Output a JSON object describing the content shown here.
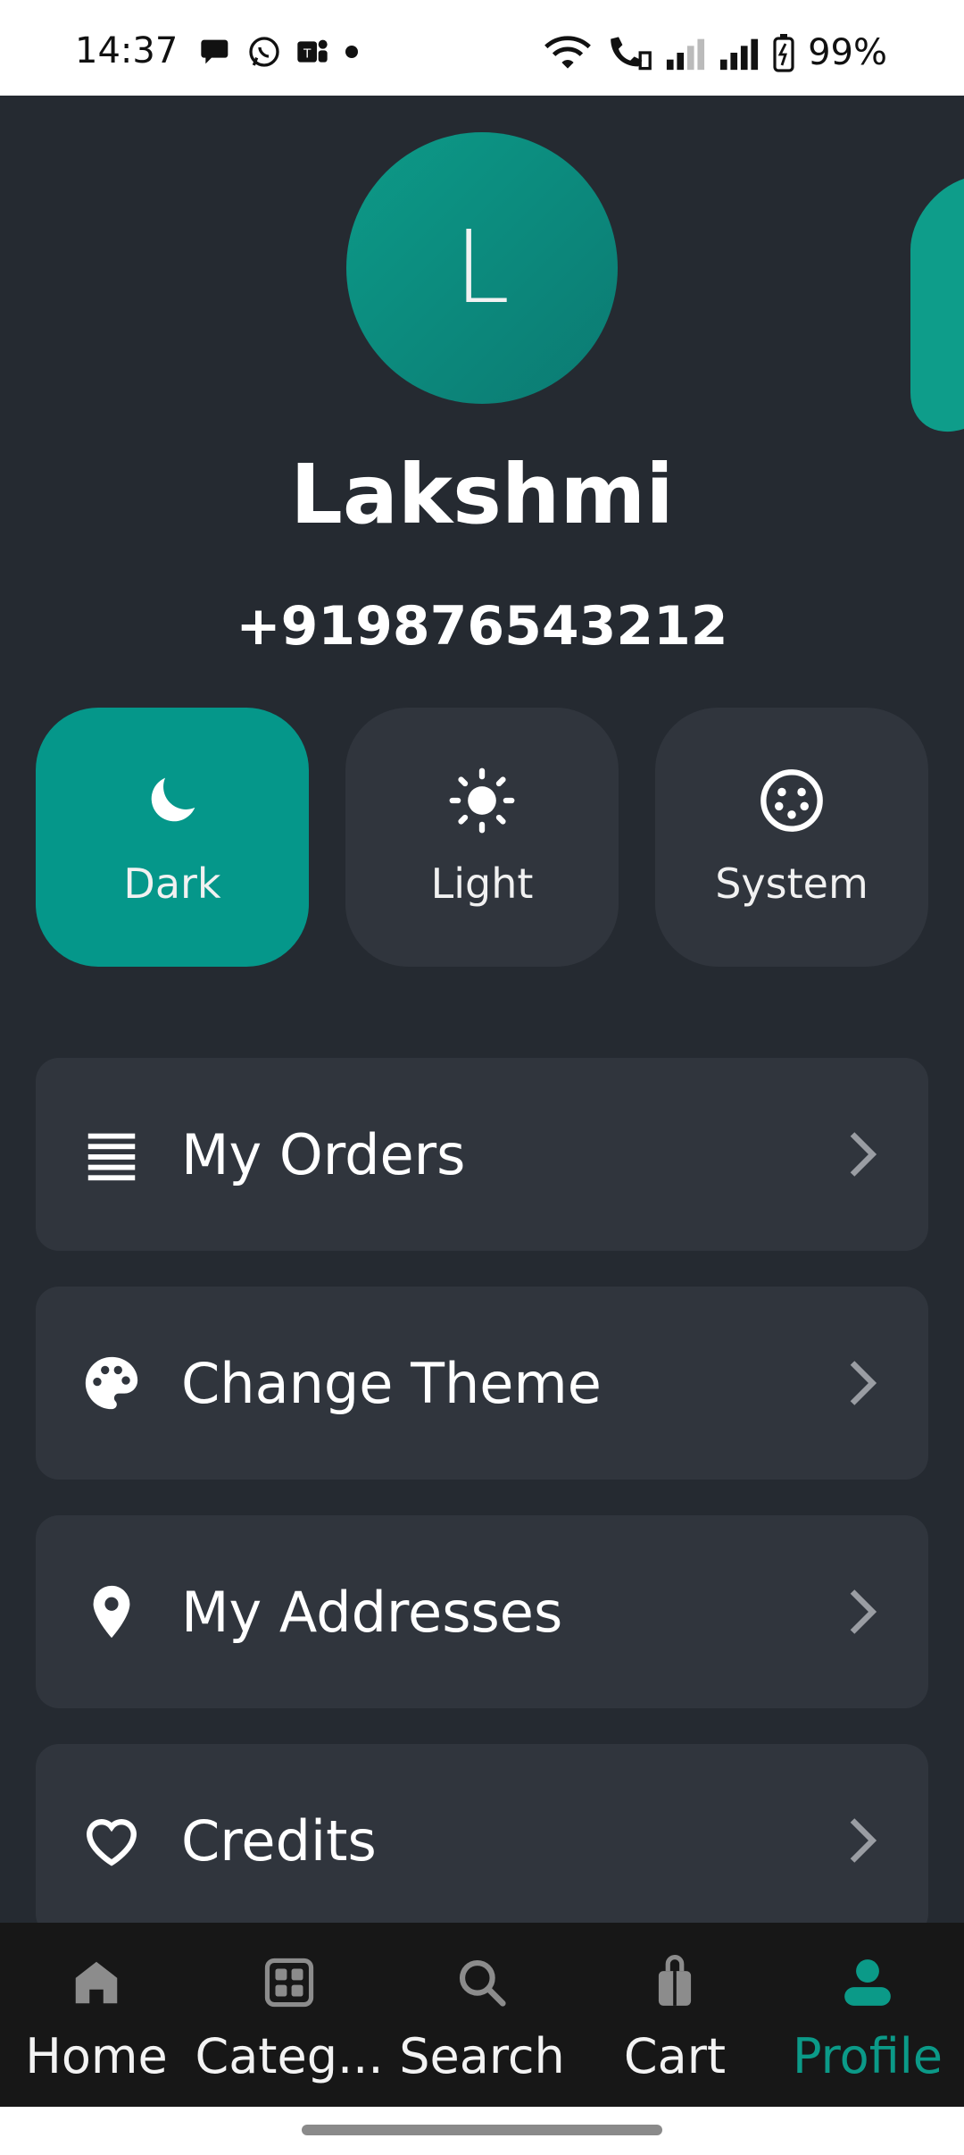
{
  "status_bar": {
    "time": "14:37",
    "battery": "99%",
    "left_icons": [
      "chat-bubble-icon",
      "whatsapp-icon",
      "teams-icon",
      "dot-icon"
    ],
    "right_icons": [
      "wifi-icon",
      "wifi-call-icon",
      "signal-weak-icon",
      "signal-full-icon",
      "battery-icon"
    ]
  },
  "profile": {
    "avatar_letter": "L",
    "name": "Lakshmi",
    "phone": "+919876543212"
  },
  "theme_options": [
    {
      "label": "Dark",
      "icon": "moon-icon",
      "active": true
    },
    {
      "label": "Light",
      "icon": "sun-icon",
      "active": false
    },
    {
      "label": "System",
      "icon": "system-icon",
      "active": false
    }
  ],
  "menu": [
    {
      "label": "My Orders",
      "icon": "list-icon"
    },
    {
      "label": "Change Theme",
      "icon": "palette-icon"
    },
    {
      "label": "My Addresses",
      "icon": "location-pin-icon"
    },
    {
      "label": "Credits",
      "icon": "heart-icon"
    }
  ],
  "bottom_nav": [
    {
      "label": "Home",
      "icon": "home-icon",
      "active": false
    },
    {
      "label": "Categ...",
      "icon": "grid-icon",
      "active": false
    },
    {
      "label": "Search",
      "icon": "search-icon",
      "active": false
    },
    {
      "label": "Cart",
      "icon": "bag-icon",
      "active": false
    },
    {
      "label": "Profile",
      "icon": "person-icon",
      "active": true
    }
  ],
  "colors": {
    "background": "#252a31",
    "card": "#30353d",
    "accent": "#05978a",
    "nav_background": "#171717"
  }
}
